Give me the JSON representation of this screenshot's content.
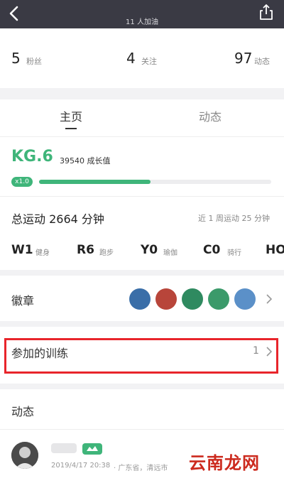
{
  "header": {
    "cheer_text": "11 人加油",
    "back_icon": "chevron-left-icon",
    "share_icon": "share-icon"
  },
  "stats": {
    "fans": {
      "value": "5",
      "label": "粉丝"
    },
    "following": {
      "value": "4",
      "label": "关注"
    },
    "posts": {
      "value": "97",
      "label": "动态"
    }
  },
  "tabs": [
    {
      "label": "主页",
      "active": true
    },
    {
      "label": "动态",
      "active": false
    }
  ],
  "level": {
    "name": "KG.6",
    "growth_text": "39540 成长值",
    "multiplier": "x1.0",
    "progress": 0.48
  },
  "exercise": {
    "total": "总运动 2664 分钟",
    "recent_week": "近 1 周运动 25 分钟",
    "categories": [
      {
        "code": "W1",
        "label": "健身"
      },
      {
        "code": "R6",
        "label": "跑步"
      },
      {
        "code": "Y0",
        "label": "瑜伽"
      },
      {
        "code": "C0",
        "label": "骑行"
      },
      {
        "code": "HO",
        "label": ""
      }
    ]
  },
  "badges": {
    "label": "徽章",
    "colors": [
      "#3a6ea8",
      "#b8453a",
      "#2f8a60",
      "#3b9a6a",
      "#5b90c8"
    ]
  },
  "training": {
    "label": "参加的训练",
    "count": "1"
  },
  "feed": {
    "section_title": "动态",
    "date": "2019/4/17 20:38",
    "location": "· 广东省，清远市"
  },
  "watermark": "云南龙网",
  "colors": {
    "accent": "#3fb57a",
    "header_bg": "#3a3a44",
    "highlight": "#e8252b"
  }
}
